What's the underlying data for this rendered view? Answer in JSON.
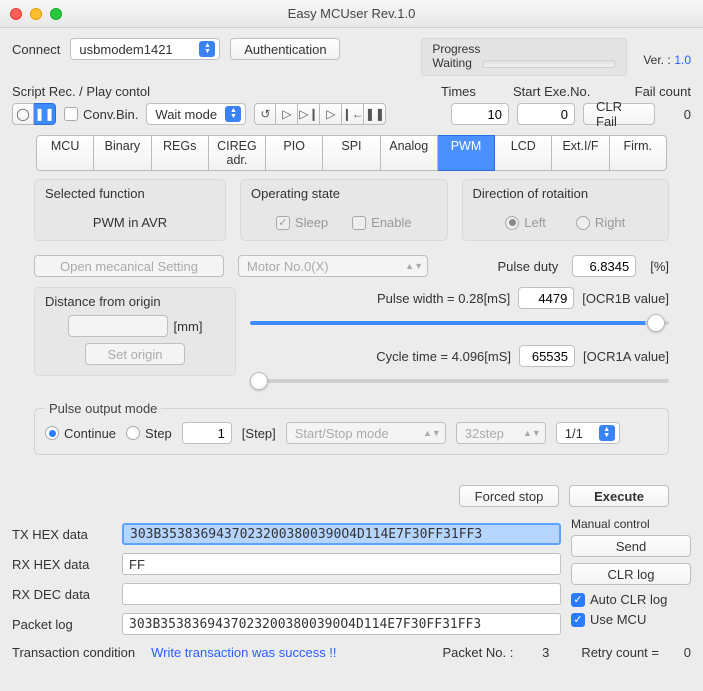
{
  "window": {
    "title": "Easy MCUser Rev.1.0"
  },
  "header": {
    "connect_label": "Connect",
    "port": "usbmodem1421",
    "auth_label": "Authentication",
    "progress_label": "Progress",
    "progress_status": "Waiting",
    "ver_label": "Ver. :",
    "ver_value": "1.0"
  },
  "script": {
    "label": "Script Rec. / Play contol",
    "convbin_label": "Conv.Bin.",
    "mode": "Wait mode",
    "times_label": "Times",
    "times_value": "10",
    "start_exe_label": "Start Exe.No.",
    "start_exe_value": "0",
    "clr_fail_label": "CLR Fail",
    "fail_count_label": "Fail count",
    "fail_count_value": "0"
  },
  "tabs": [
    "MCU",
    "Binary",
    "REGs",
    "CIREG adr.",
    "PIO",
    "SPI",
    "Analog",
    "PWM",
    "LCD",
    "Ext.I/F",
    "Firm."
  ],
  "active_tab": 7,
  "pwm": {
    "selected_fn_label": "Selected function",
    "selected_fn_value": "PWM in AVR",
    "op_state_label": "Operating state",
    "sleep_label": "Sleep",
    "enable_label": "Enable",
    "dir_label": "Direction of rotaition",
    "left_label": "Left",
    "right_label": "Right",
    "open_mech_label": "Open mecanical Setting",
    "motor_sel": "Motor No.0(X)",
    "pulse_duty_label": "Pulse duty",
    "pulse_duty_value": "6.8345",
    "pulse_duty_unit": "[%]",
    "dist_label": "Distance from origin",
    "dist_unit": "[mm]",
    "set_origin_label": "Set origin",
    "pulse_width_label": "Pulse width = 0.28[mS]",
    "ocr1b_value": "4479",
    "ocr1b_label": "[OCR1B value]",
    "cycle_time_label": "Cycle time = 4.096[mS]",
    "ocr1a_value": "65535",
    "ocr1a_label": "[OCR1A value]",
    "pulse_out_label": "Pulse output mode",
    "continue_label": "Continue",
    "step_label": "Step",
    "step_value": "1",
    "step_unit": "[Step]",
    "startstop_sel": "Start/Stop mode",
    "step32_sel": "32step",
    "ratio_sel": "1/1",
    "forced_stop_label": "Forced stop",
    "execute_label": "Execute"
  },
  "bottom": {
    "tx_label": "TX HEX data",
    "tx_value": "303B35383694370232003800390O4D114E7F30FF31FF3",
    "rx_label": "RX HEX data",
    "rx_value": "FF",
    "rxdec_label": "RX DEC data",
    "rxdec_value": "",
    "pkt_label": "Packet log",
    "pkt_value": "303B35383694370232003800390O4D114E7F30FF31FF3",
    "manual_label": "Manual control",
    "send_label": "Send",
    "clr_log_label": "CLR log",
    "auto_clr_label": "Auto CLR log",
    "use_mcu_label": "Use MCU",
    "trans_cond_label": "Transaction condition",
    "trans_cond_msg": "Write transaction was success !!",
    "pkt_no_label": "Packet No. :",
    "pkt_no_value": "3",
    "retry_label": "Retry count  =",
    "retry_value": "0"
  }
}
